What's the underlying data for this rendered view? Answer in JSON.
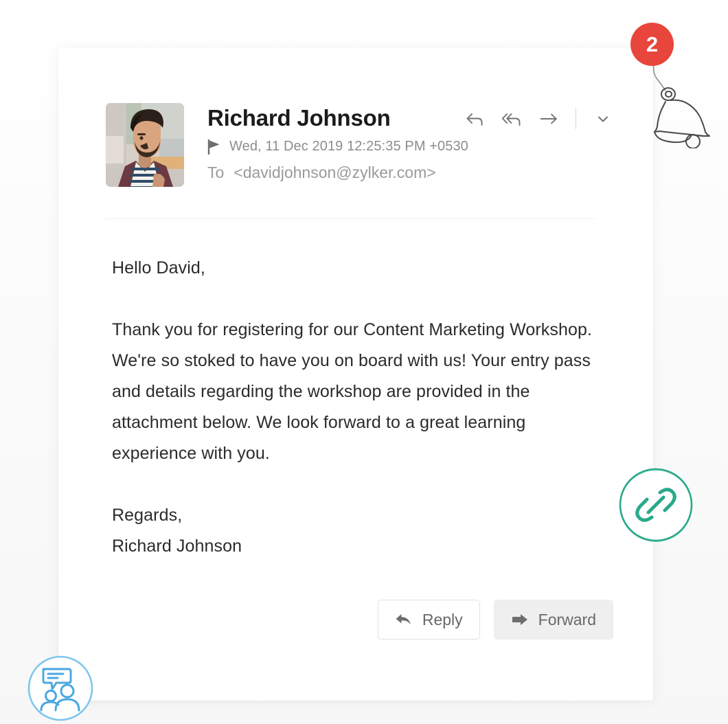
{
  "page": {
    "background_color": "#fbfbfb"
  },
  "notification": {
    "count": "2",
    "badge_color": "#e8453c",
    "bell_icon": "bell-icon"
  },
  "message": {
    "sender_name": "Richard Johnson",
    "avatar_alt": "sender-photo",
    "flag_icon": "flag-icon",
    "date": "Wed, 11 Dec 2019 12:25:35 PM +0530",
    "to_label": "To",
    "recipient": "<davidjohnson@zylker.com>",
    "actions": [
      {
        "name": "reply-icon",
        "label": "Reply"
      },
      {
        "name": "reply-all-icon",
        "label": "Reply All"
      },
      {
        "name": "forward-icon",
        "label": "Forward"
      },
      {
        "name": "chevron-down-icon",
        "label": "More"
      }
    ],
    "body": {
      "greeting": "Hello David,",
      "paragraph": "Thank you for registering for our Content Marketing Workshop. We're so stoked to have you on board with us! Your entry pass and details regarding the workshop are provided in the attachment below. We look forward to a great learning experience with you.",
      "signoff": "Regards,",
      "signature_name": "Richard Johnson"
    }
  },
  "footer": {
    "reply_label": "Reply",
    "forward_label": "Forward"
  },
  "floating_icons": {
    "attachment": {
      "name": "link-attachment-icon",
      "color": "#2aa98a"
    },
    "contacts": {
      "name": "contacts-chat-icon",
      "color": "#56b4e8"
    }
  }
}
